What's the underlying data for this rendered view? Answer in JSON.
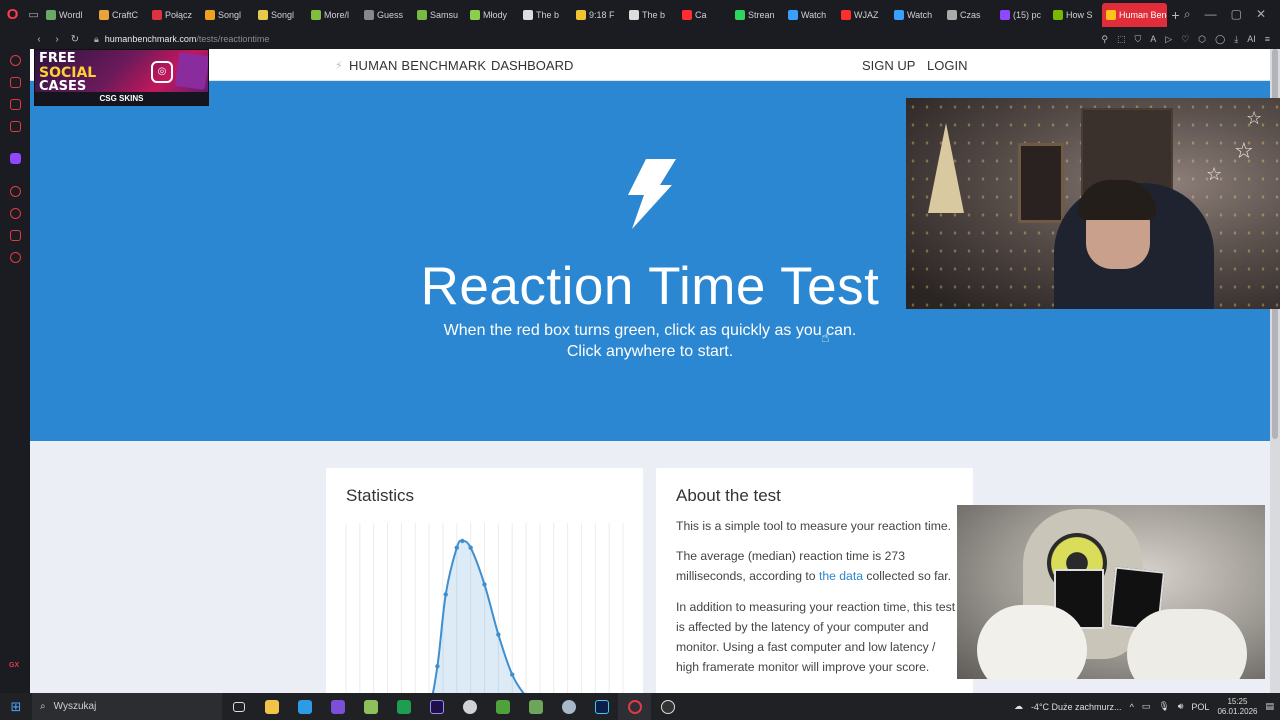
{
  "browser": {
    "tabs": [
      {
        "label": "Wordl",
        "color": "#6aaa64"
      },
      {
        "label": "CraftC",
        "color": "#e8a33a"
      },
      {
        "label": "Połącz",
        "color": "#dd3340"
      },
      {
        "label": "Songl",
        "color": "#f0a020"
      },
      {
        "label": "Songl",
        "color": "#e6c84a"
      },
      {
        "label": "More/l",
        "color": "#7fbf3f"
      },
      {
        "label": "Guess",
        "color": "#888888"
      },
      {
        "label": "Samsu",
        "color": "#77bb44"
      },
      {
        "label": "Młody",
        "color": "#8ccf4e"
      },
      {
        "label": "The b",
        "color": "#dddddd"
      },
      {
        "label": "9:18 F",
        "color": "#f2c230"
      },
      {
        "label": "The b",
        "color": "#dddddd"
      },
      {
        "label": "Ca",
        "color": "#ff2d2d"
      },
      {
        "label": "Strean",
        "color": "#2fd65d"
      },
      {
        "label": "Watch",
        "color": "#3aa0ff"
      },
      {
        "label": "WJAZ",
        "color": "#ff2d2d"
      },
      {
        "label": "Watch",
        "color": "#3aa0ff"
      },
      {
        "label": "Czas",
        "color": "#aaaaaa"
      },
      {
        "label": "(15) pc",
        "color": "#9146ff"
      },
      {
        "label": "How S",
        "color": "#76b900"
      }
    ],
    "active_tab": {
      "label": "Human Benc",
      "color": "#ffc21a"
    },
    "url_domain": "humanbenchmark.com",
    "url_path": "/tests/reactiontime",
    "sidebar_label": "GX"
  },
  "header": {
    "brand": "HUMAN BENCHMARK",
    "dashboard": "DASHBOARD",
    "signup": "SIGN UP",
    "login": "LOGIN"
  },
  "hero": {
    "title": "Reaction Time Test",
    "subtitle_line1": "When the red box turns green, click as quickly as you can.",
    "subtitle_line2": "Click anywhere to start."
  },
  "statistics": {
    "title": "Statistics"
  },
  "about": {
    "title": "About the test",
    "p1": "This is a simple tool to measure your reaction time.",
    "p2_before": "The average (median) reaction time is 273 milliseconds, according to ",
    "p2_link": "the data",
    "p2_after": " collected so far.",
    "p3": "In addition to measuring your reaction time, this test is affected by the latency of your computer and monitor. Using a fast computer and low latency / high framerate monitor will improve your score."
  },
  "ad": {
    "line1": "FREE",
    "line2": "SOCIAL",
    "line3": "CASES",
    "brand": "CSG SKINS"
  },
  "taskbar": {
    "search": "Wyszukaj",
    "weather": "-4°C  Duże zachmurz...",
    "lang": "POL",
    "time": "15:25",
    "date": "06.01.2026"
  },
  "chart_data": {
    "type": "area",
    "title": "",
    "xlabel": "",
    "ylabel": "",
    "grid": true,
    "series": [
      {
        "values": [
          {
            "x": 0.0,
            "y": 0.0
          },
          {
            "x": 0.05,
            "y": 0.0
          },
          {
            "x": 0.1,
            "y": 0.0
          },
          {
            "x": 0.15,
            "y": 0.0
          },
          {
            "x": 0.2,
            "y": 0.0
          },
          {
            "x": 0.25,
            "y": 0.0
          },
          {
            "x": 0.3,
            "y": 0.02
          },
          {
            "x": 0.33,
            "y": 0.25
          },
          {
            "x": 0.36,
            "y": 0.68
          },
          {
            "x": 0.4,
            "y": 0.96
          },
          {
            "x": 0.42,
            "y": 1.0
          },
          {
            "x": 0.45,
            "y": 0.96
          },
          {
            "x": 0.5,
            "y": 0.74
          },
          {
            "x": 0.55,
            "y": 0.44
          },
          {
            "x": 0.6,
            "y": 0.2
          },
          {
            "x": 0.65,
            "y": 0.07
          },
          {
            "x": 0.7,
            "y": 0.0
          }
        ]
      }
    ],
    "xlim": [
      0,
      1
    ],
    "ylim": [
      0,
      1
    ],
    "color": "#3f8fcf"
  }
}
